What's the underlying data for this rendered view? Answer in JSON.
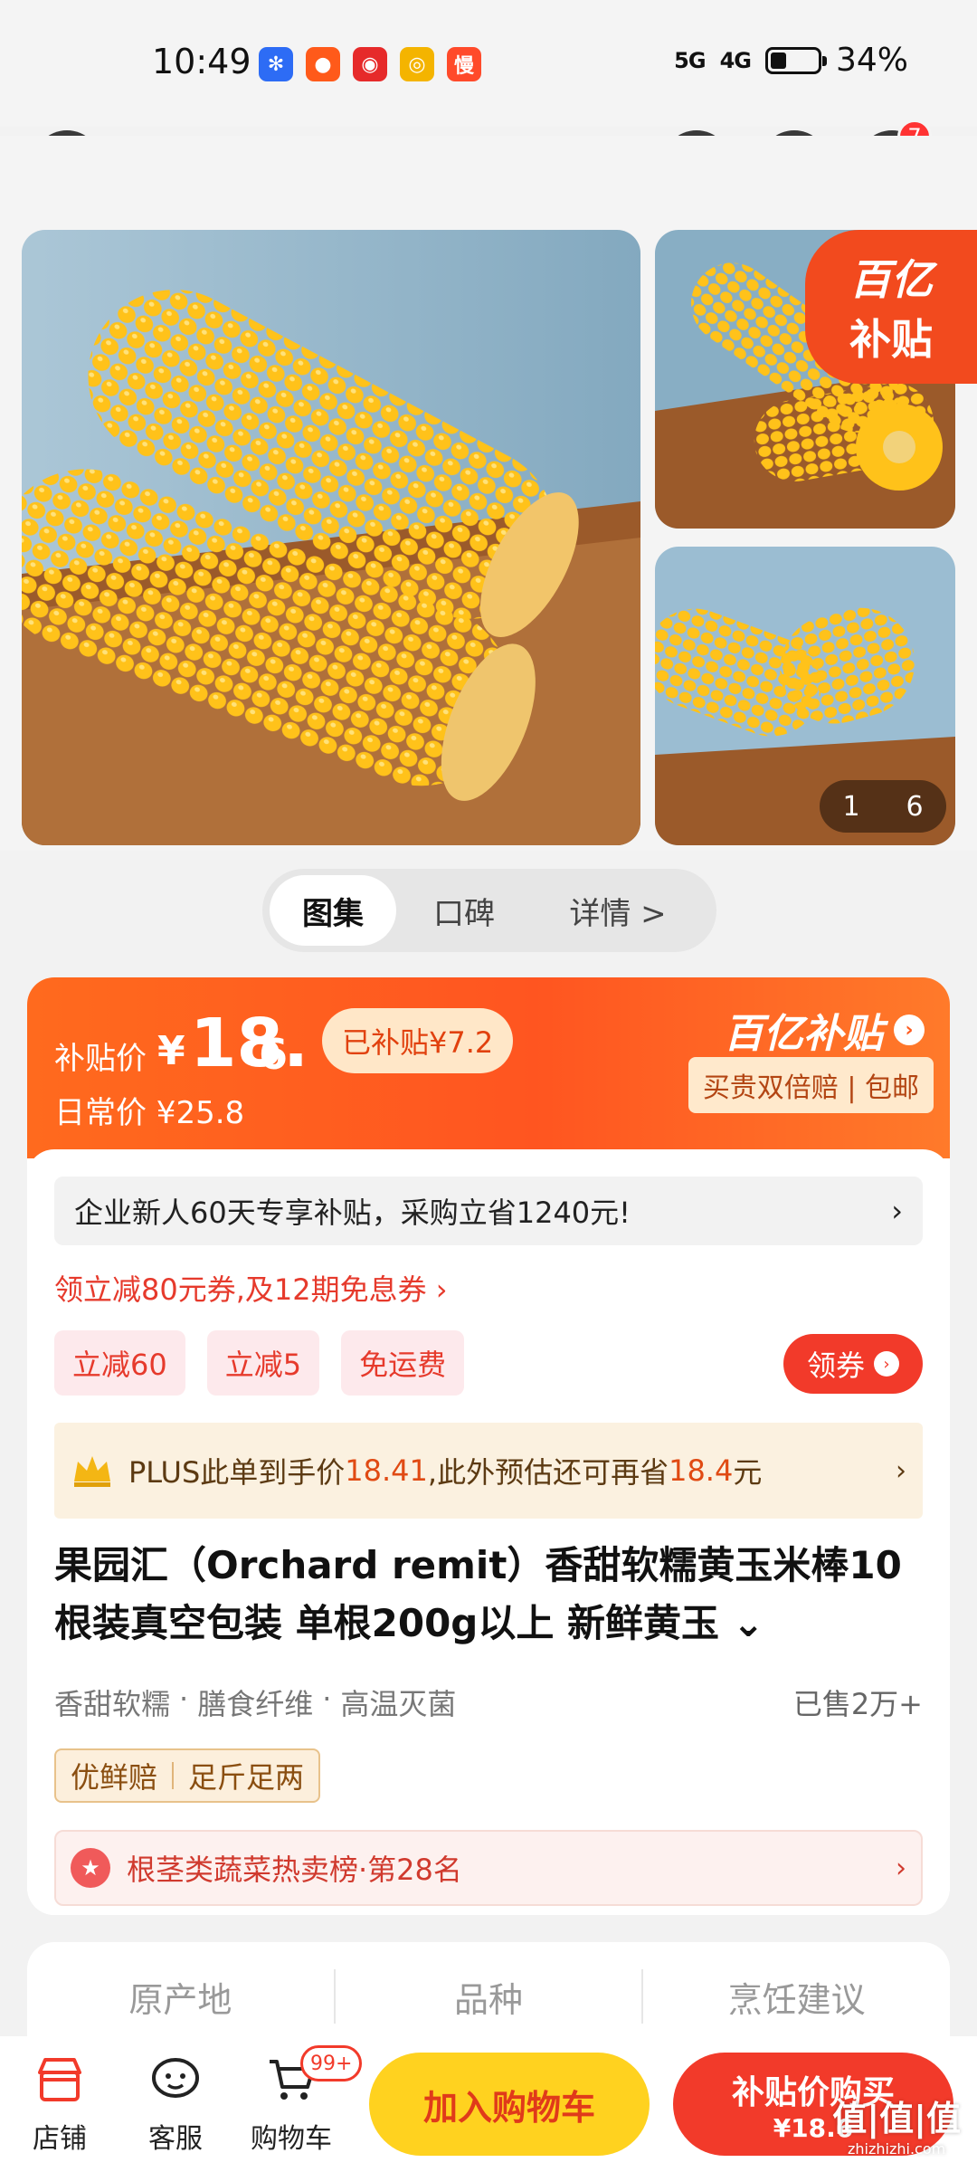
{
  "status_bar": {
    "time": "10:49",
    "signal_1": "5G",
    "signal_2": "4G",
    "battery_percent": "34%",
    "battery_level": 0.34,
    "app_icons": [
      "baidu-icon",
      "taobao-icon",
      "jd-icon",
      "weibo-icon",
      "man-icon"
    ]
  },
  "nav": {
    "back_icon": "back-arrow-icon",
    "favorite_icon": "star-icon",
    "share_icon": "share-icon",
    "more_icon": "more-dots-icon",
    "more_badge": "7"
  },
  "gallery": {
    "corner_badge_line1": "百亿",
    "corner_badge_line2": "补贴",
    "counter_current": "1",
    "counter_total": "6"
  },
  "tabs": [
    {
      "label": "图集",
      "active": true
    },
    {
      "label": "口碑",
      "active": false
    },
    {
      "label": "详情 >",
      "active": false
    }
  ],
  "price": {
    "label": "补贴价",
    "currency": "¥",
    "integer": "18.",
    "decimal": "6",
    "subsidized_pill": "已补贴¥7.2",
    "daily_price": "日常价 ¥25.8",
    "brand": "百亿补贴",
    "guarantee": "买贵双倍赔 | 包邮"
  },
  "promo": {
    "enterprise_text": "企业新人60天专享补贴，采购立省1240元!",
    "enterprise_arrow": "›",
    "coupon_link": "领立减80元券,及12期免息券 ›",
    "chips": [
      "立减60",
      "立减5",
      "免运费"
    ],
    "get_coupon": "领券",
    "plus_prefix": "PLUS此单到手价",
    "plus_price": "18.41",
    "plus_middle": ",此外预估还可再省",
    "plus_save": "18.4",
    "plus_suffix": "元",
    "plus_arrow": "›"
  },
  "product": {
    "title": "果园汇（Orchard remit）香甜软糯黄玉米棒10根装真空包装 单根200g以上 新鲜黄玉 ⌄",
    "tag1": "香甜软糯",
    "tag2": "膳食纤维",
    "tag3": "高温灭菌",
    "sold": "已售2万+",
    "guarantee1": "优鲜赔",
    "guarantee2": "足斤足两",
    "rank": "根茎类蔬菜热卖榜·第28名",
    "rank_arrow": "›"
  },
  "specs": [
    "原产地",
    "品种",
    "烹饪建议"
  ],
  "bottom_bar": {
    "store": "店铺",
    "service": "客服",
    "cart": "购物车",
    "cart_badge": "99+",
    "add_to_cart": "加入购物车",
    "buy_line1": "补贴价购买",
    "buy_line2": "¥18.6",
    "watermark": "值|值|值",
    "watermark_sub": "zhizhizhi.com"
  }
}
